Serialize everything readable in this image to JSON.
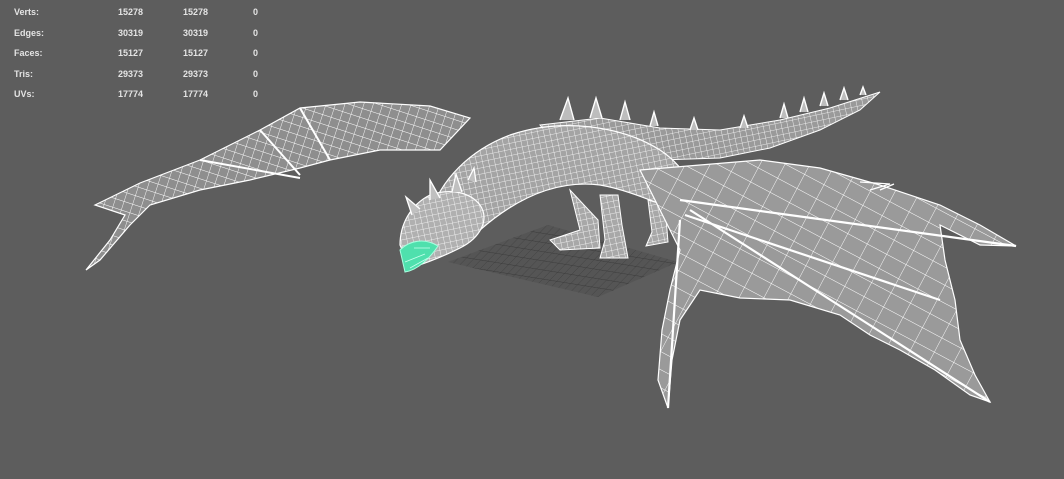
{
  "hud": {
    "rows": [
      {
        "label": "Verts:",
        "values": [
          "15278",
          "15278",
          "0"
        ]
      },
      {
        "label": "Edges:",
        "values": [
          "30319",
          "30319",
          "0"
        ]
      },
      {
        "label": "Faces:",
        "values": [
          "15127",
          "15127",
          "0"
        ]
      },
      {
        "label": "Tris:",
        "values": [
          "29373",
          "29373",
          "0"
        ]
      },
      {
        "label": "UVs:",
        "values": [
          "17774",
          "17774",
          "0"
        ]
      }
    ]
  },
  "colors": {
    "viewport_bg": "#5d5d5d",
    "wireframe": "#ffffff",
    "wing_membrane": "#9a9a9a",
    "selection": "#4fe0ad",
    "grid": "#3c3c3c"
  },
  "scene": {
    "object": "dragon-wireframe-mesh",
    "shading": "wireframe-on-shaded",
    "grid_visible": true
  }
}
